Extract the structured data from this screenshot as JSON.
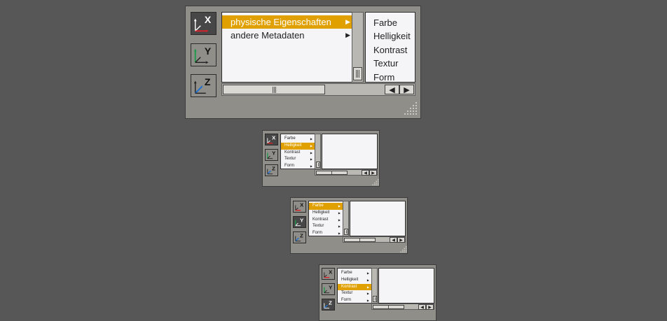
{
  "axes": {
    "x_label": "X",
    "y_label": "Y",
    "z_label": "Z"
  },
  "arrow_right": "▶",
  "arrow_left": "◀",
  "panels": [
    {
      "col1": [
        "physische Eigenschaften",
        "andere Metadaten"
      ],
      "col2": [
        "Farbe",
        "Helligkeit",
        "Kontrast",
        "Textur",
        "Form"
      ]
    },
    {
      "col1": [
        "Farbe",
        "Helligkeit",
        "Kontrast",
        "Textur",
        "Form"
      ]
    },
    {
      "col1": [
        "Farbe",
        "Helligkeit",
        "Kontrast",
        "Textur",
        "Form"
      ]
    },
    {
      "col1": [
        "Farbe",
        "Helligkeit",
        "Kontrast",
        "Textur",
        "Form"
      ]
    }
  ],
  "colors": {
    "background": "#575757",
    "panel": "#8f8e89",
    "selection": "#e0a100",
    "list": "#f5f5f7"
  }
}
